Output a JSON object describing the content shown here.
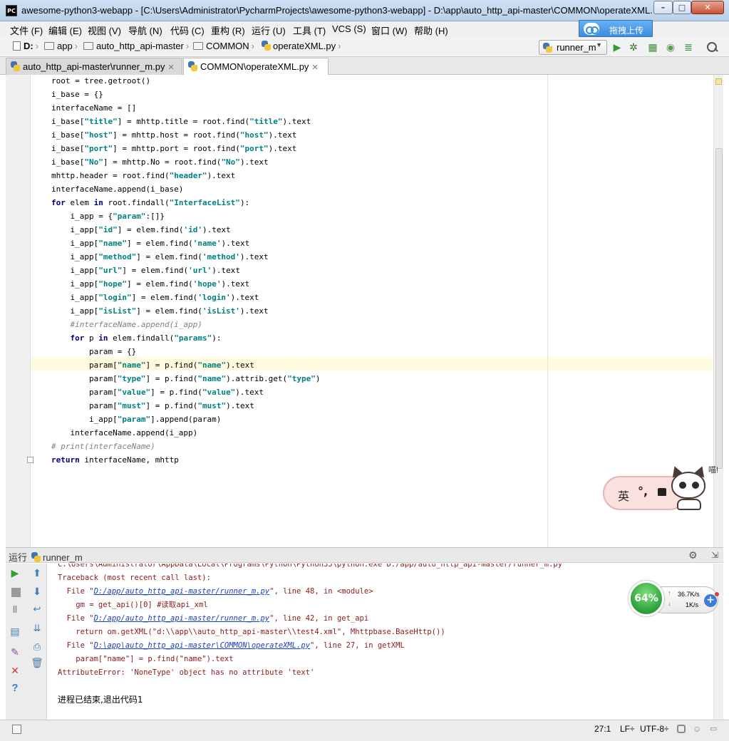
{
  "window": {
    "title": "awesome-python3-webapp - [C:\\Users\\Administrator\\PycharmProjects\\awesome-python3-webapp] - D:\\app\\auto_http_api-master\\COMMON\\operateXML.py",
    "app_icon_text": "PC",
    "minimize": "–",
    "maximize": "□",
    "close": "✕"
  },
  "menu": [
    "文件 (F)",
    "编辑 (E)",
    "视图 (V)",
    "导航 (N)",
    "代码 (C)",
    "重构 (R)",
    "运行 (U)",
    "工具 (T)",
    "VCS (S)",
    "窗口 (W)",
    "帮助 (H)"
  ],
  "upload_badge": "拖拽上传",
  "breadcrumb": [
    "D:",
    "app",
    "auto_http_api-master",
    "COMMON",
    "operateXML.py"
  ],
  "run_config": "runner_m",
  "tabs": [
    {
      "label": "auto_http_api-master\\runner_m.py",
      "active": false
    },
    {
      "label": "COMMON\\operateXML.py",
      "active": true
    }
  ],
  "code": [
    [
      {
        "t": "root = tree.getroot()"
      }
    ],
    [
      {
        "t": "i_base = {}"
      }
    ],
    [
      {
        "t": "interfaceName = []"
      }
    ],
    [
      {
        "t": "i_base["
      },
      {
        "t": "\"title\"",
        "c": "str"
      },
      {
        "t": "] = mhttp.title = root.find("
      },
      {
        "t": "\"title\"",
        "c": "str"
      },
      {
        "t": ").text"
      }
    ],
    [
      {
        "t": "i_base["
      },
      {
        "t": "\"host\"",
        "c": "str"
      },
      {
        "t": "] = mhttp.host = root.find("
      },
      {
        "t": "\"host\"",
        "c": "str"
      },
      {
        "t": ").text"
      }
    ],
    [
      {
        "t": "i_base["
      },
      {
        "t": "\"port\"",
        "c": "str"
      },
      {
        "t": "] = mhttp.port = root.find("
      },
      {
        "t": "\"port\"",
        "c": "str"
      },
      {
        "t": ").text"
      }
    ],
    [
      {
        "t": "i_base["
      },
      {
        "t": "\"No\"",
        "c": "str"
      },
      {
        "t": "] = mhttp.No = root.find("
      },
      {
        "t": "\"No\"",
        "c": "str"
      },
      {
        "t": ").text"
      }
    ],
    [
      {
        "t": "mhttp.header = root.find("
      },
      {
        "t": "\"header\"",
        "c": "str"
      },
      {
        "t": ").text"
      }
    ],
    [
      {
        "t": "interfaceName.append(i_base)"
      }
    ],
    [
      {
        "t": "for",
        "c": "kw"
      },
      {
        "t": " elem "
      },
      {
        "t": "in",
        "c": "kw"
      },
      {
        "t": " root.findall("
      },
      {
        "t": "\"InterfaceList\"",
        "c": "str"
      },
      {
        "t": "):"
      }
    ],
    [
      {
        "t": "    i_app = {"
      },
      {
        "t": "\"param\"",
        "c": "str"
      },
      {
        "t": ":[]}"
      }
    ],
    [
      {
        "t": "    i_app["
      },
      {
        "t": "\"id\"",
        "c": "str"
      },
      {
        "t": "] = elem.find("
      },
      {
        "t": "'id'",
        "c": "str"
      },
      {
        "t": ").text"
      }
    ],
    [
      {
        "t": "    i_app["
      },
      {
        "t": "\"name\"",
        "c": "str"
      },
      {
        "t": "] = elem.find("
      },
      {
        "t": "'name'",
        "c": "str"
      },
      {
        "t": ").text"
      }
    ],
    [
      {
        "t": "    i_app["
      },
      {
        "t": "\"method\"",
        "c": "str"
      },
      {
        "t": "] = elem.find("
      },
      {
        "t": "'method'",
        "c": "str"
      },
      {
        "t": ").text"
      }
    ],
    [
      {
        "t": "    i_app["
      },
      {
        "t": "\"url\"",
        "c": "str"
      },
      {
        "t": "] = elem.find("
      },
      {
        "t": "'url'",
        "c": "str"
      },
      {
        "t": ").text"
      }
    ],
    [
      {
        "t": "    i_app["
      },
      {
        "t": "\"hope\"",
        "c": "str"
      },
      {
        "t": "] = elem.find("
      },
      {
        "t": "'hope'",
        "c": "str"
      },
      {
        "t": ").text"
      }
    ],
    [
      {
        "t": "    i_app["
      },
      {
        "t": "\"login\"",
        "c": "str"
      },
      {
        "t": "] = elem.find("
      },
      {
        "t": "'login'",
        "c": "str"
      },
      {
        "t": ").text"
      }
    ],
    [
      {
        "t": "    i_app["
      },
      {
        "t": "\"isList\"",
        "c": "str"
      },
      {
        "t": "] = elem.find("
      },
      {
        "t": "'isList'",
        "c": "str"
      },
      {
        "t": ").text"
      }
    ],
    [
      {
        "t": "    #interfaceName.append(i_app)",
        "c": "cmt"
      }
    ],
    [
      {
        "t": "    "
      },
      {
        "t": "for",
        "c": "kw"
      },
      {
        "t": " p "
      },
      {
        "t": "in",
        "c": "kw"
      },
      {
        "t": " elem.findall("
      },
      {
        "t": "\"params\"",
        "c": "str"
      },
      {
        "t": "):"
      }
    ],
    [
      {
        "t": "        param = {}"
      }
    ],
    [
      {
        "t": "        param["
      },
      {
        "t": "\"name\"",
        "c": "str"
      },
      {
        "t": "] = p.find("
      },
      {
        "t": "\"name\"",
        "c": "str"
      },
      {
        "t": ").text"
      }
    ],
    [
      {
        "t": "        param["
      },
      {
        "t": "\"type\"",
        "c": "str"
      },
      {
        "t": "] = p.find("
      },
      {
        "t": "\"name\"",
        "c": "str"
      },
      {
        "t": ").attrib.get("
      },
      {
        "t": "\"type\"",
        "c": "str"
      },
      {
        "t": ")"
      }
    ],
    [
      {
        "t": "        param["
      },
      {
        "t": "\"value\"",
        "c": "str"
      },
      {
        "t": "] = p.find("
      },
      {
        "t": "\"value\"",
        "c": "str"
      },
      {
        "t": ").text"
      }
    ],
    [
      {
        "t": "        param["
      },
      {
        "t": "\"must\"",
        "c": "str"
      },
      {
        "t": "] = p.find("
      },
      {
        "t": "\"must\"",
        "c": "str"
      },
      {
        "t": ").text"
      }
    ],
    [
      {
        "t": "        i_app["
      },
      {
        "t": "\"param\"",
        "c": "str"
      },
      {
        "t": "].append(param)"
      }
    ],
    [
      {
        "t": "    interfaceName.append(i_app)"
      }
    ],
    [
      {
        "t": "# print(interfaceName)",
        "c": "cmt"
      }
    ],
    [
      {
        "t": "return",
        "c": "kw"
      },
      {
        "t": " interfaceName, mhttp"
      }
    ]
  ],
  "run_panel": {
    "title": "运行",
    "config": "runner_m",
    "settings_icon": "⚙",
    "hide_icon": "⇲"
  },
  "console": [
    [
      {
        "t": "C:\\Users\\Administrator\\AppData\\Local\\Programs\\Python\\Python35\\python.exe D:/app/auto_http_api-master/runner_m.py"
      }
    ],
    [
      {
        "t": "Traceback (most recent call last):"
      }
    ],
    [
      {
        "t": "  File \""
      },
      {
        "t": "D:/app/auto_http_api-master/runner_m.py",
        "c": "lnk"
      },
      {
        "t": "\", line 48, in <module>"
      }
    ],
    [
      {
        "t": "    gm = get_api()[0] #读取api_xml"
      }
    ],
    [
      {
        "t": "  File \""
      },
      {
        "t": "D:/app/auto_http_api-master/runner_m.py",
        "c": "lnk"
      },
      {
        "t": "\", line 42, in get_api"
      }
    ],
    [
      {
        "t": "    return om.getXML(\"d:\\\\app\\\\auto_http_api-master\\\\test4.xml\", Mhttpbase.BaseHttp())"
      }
    ],
    [
      {
        "t": "  File \""
      },
      {
        "t": "D:\\app\\auto_http_api-master\\COMMON\\operateXML.py",
        "c": "lnk"
      },
      {
        "t": "\", line 27, in getXML"
      }
    ],
    [
      {
        "t": "    param[\"name\"] = p.find(\"name\").text"
      }
    ],
    [
      {
        "t": "AttributeError: 'NoneType' object has no attribute 'text'"
      }
    ],
    [],
    [
      {
        "t": "进程已结束,退出代码1",
        "c": "exitline"
      }
    ]
  ],
  "sticker": {
    "lang": "英",
    "punct": "°,",
    "meow": "喵!"
  },
  "net_meter": {
    "percent": "64%",
    "percent_value": 64,
    "upload_speed": "36.7K/s",
    "download_speed": "1K/s",
    "up_arrow": "↑",
    "down_arrow": "↓",
    "plus": "+"
  },
  "status": {
    "caret": "27:1",
    "line_sep": "LF÷",
    "encoding": "UTF-8÷"
  },
  "colors": {
    "keyword": "#000080",
    "string": "#008080",
    "comment": "#808080",
    "error_text": "#8b1a1a",
    "link": "#1a3fc9",
    "current_line": "#fffbe1"
  }
}
